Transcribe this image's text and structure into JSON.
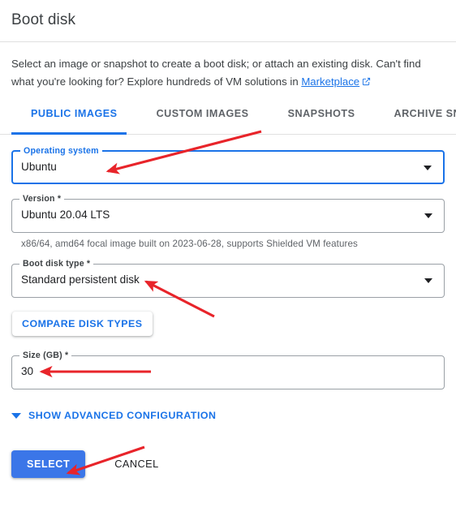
{
  "dialog": {
    "title": "Boot disk",
    "description_part1": "Select an image or snapshot to create a boot disk; or attach an existing disk. Can't find what you're looking for? Explore hundreds of VM solutions in ",
    "marketplace_link": "Marketplace",
    "external_link_icon": "external-link-icon"
  },
  "tabs": [
    {
      "label": "PUBLIC IMAGES",
      "active": true
    },
    {
      "label": "CUSTOM IMAGES",
      "active": false
    },
    {
      "label": "SNAPSHOTS",
      "active": false
    },
    {
      "label": "ARCHIVE SNAPSHOTS",
      "active": false
    }
  ],
  "fields": {
    "operating_system": {
      "label": "Operating system",
      "value": "Ubuntu",
      "focused": true
    },
    "version": {
      "label": "Version *",
      "value": "Ubuntu 20.04 LTS",
      "helper": "x86/64, amd64 focal image built on 2023-06-28, supports Shielded VM features"
    },
    "boot_disk_type": {
      "label": "Boot disk type *",
      "value": "Standard persistent disk"
    },
    "size": {
      "label": "Size (GB) *",
      "value": "30"
    }
  },
  "buttons": {
    "compare_disk_types": "COMPARE DISK TYPES",
    "show_advanced": "SHOW ADVANCED CONFIGURATION",
    "select": "SELECT",
    "cancel": "CANCEL"
  },
  "colors": {
    "accent_blue": "#1a73e8",
    "button_blue": "#3b76e8",
    "annotation_red": "#e8242a",
    "text_primary": "#202124",
    "text_secondary": "#5f6368"
  },
  "annotations": {
    "arrow_os": "arrow-pointing-to-operating-system-field",
    "arrow_disk_type": "arrow-pointing-to-boot-disk-type-field",
    "arrow_size": "arrow-pointing-to-size-field",
    "arrow_select": "arrow-pointing-to-select-button"
  }
}
